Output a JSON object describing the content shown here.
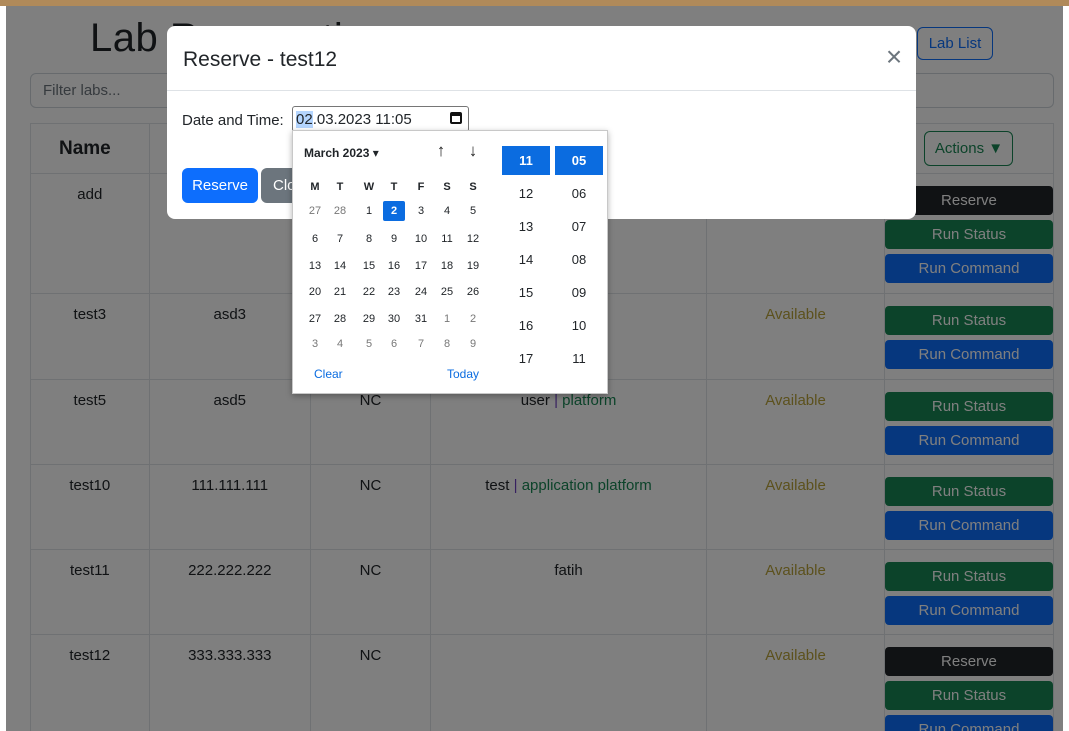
{
  "page": {
    "title": "Lab Reservations",
    "lab_list_label": "Lab List",
    "filter_placeholder": "Filter labs...",
    "actions_label": "Actions ▼"
  },
  "table": {
    "name_header": "Name",
    "rows": [
      {
        "name": "add",
        "ip": "",
        "type": "",
        "user": "",
        "tags": "",
        "status": "",
        "actions": [
          "Reserve",
          "Run Status",
          "Run Command"
        ]
      },
      {
        "name": "test3",
        "ip": "asd3",
        "type": "",
        "user": "",
        "tags": "",
        "status": "Available",
        "actions": [
          "Run Status",
          "Run Command"
        ]
      },
      {
        "name": "test5",
        "ip": "asd5",
        "type": "NC",
        "user": "user",
        "tags": "platform",
        "status": "Available",
        "actions": [
          "Run Status",
          "Run Command"
        ]
      },
      {
        "name": "test10",
        "ip": "111.111.111",
        "type": "NC",
        "user": "test",
        "tags": "application platform",
        "status": "Available",
        "actions": [
          "Run Status",
          "Run Command"
        ]
      },
      {
        "name": "test11",
        "ip": "222.222.222",
        "type": "NC",
        "user": "fatih",
        "tags": "",
        "status": "Available",
        "actions": [
          "Run Status",
          "Run Command"
        ]
      },
      {
        "name": "test12",
        "ip": "333.333.333",
        "type": "NC",
        "user": "",
        "tags": "",
        "status": "Available",
        "actions": [
          "Reserve",
          "Run Status",
          "Run Command"
        ]
      }
    ],
    "separator": "|"
  },
  "modal": {
    "title": "Reserve - test12",
    "close_glyph": "×",
    "datetime_label": "Date and Time:",
    "datetime_day": "02",
    "datetime_rest": ".03.2023 11:05",
    "reserve_label": "Reserve",
    "close_label": "Close"
  },
  "picker": {
    "month_label": "March 2023 ▾",
    "up_arrow": "↑",
    "down_arrow": "↓",
    "weekdays": [
      "M",
      "T",
      "W",
      "T",
      "F",
      "S",
      "S"
    ],
    "weeks": [
      [
        "27",
        "28",
        "1",
        "2",
        "3",
        "4",
        "5"
      ],
      [
        "6",
        "7",
        "8",
        "9",
        "10",
        "11",
        "12"
      ],
      [
        "13",
        "14",
        "15",
        "16",
        "17",
        "18",
        "19"
      ],
      [
        "20",
        "21",
        "22",
        "23",
        "24",
        "25",
        "26"
      ],
      [
        "27",
        "28",
        "29",
        "30",
        "31",
        "1",
        "2"
      ],
      [
        "3",
        "4",
        "5",
        "6",
        "7",
        "8",
        "9"
      ]
    ],
    "selected_day": "2",
    "clear_label": "Clear",
    "today_label": "Today",
    "hours": [
      "11",
      "12",
      "13",
      "14",
      "15",
      "16",
      "17"
    ],
    "minutes": [
      "05",
      "06",
      "07",
      "08",
      "09",
      "10",
      "11"
    ],
    "selected_hour": "11",
    "selected_minute": "05"
  },
  "colors": {
    "primary": "#0d6efd",
    "success": "#198754",
    "dark": "#212529",
    "status_available": "#b9a33a"
  }
}
